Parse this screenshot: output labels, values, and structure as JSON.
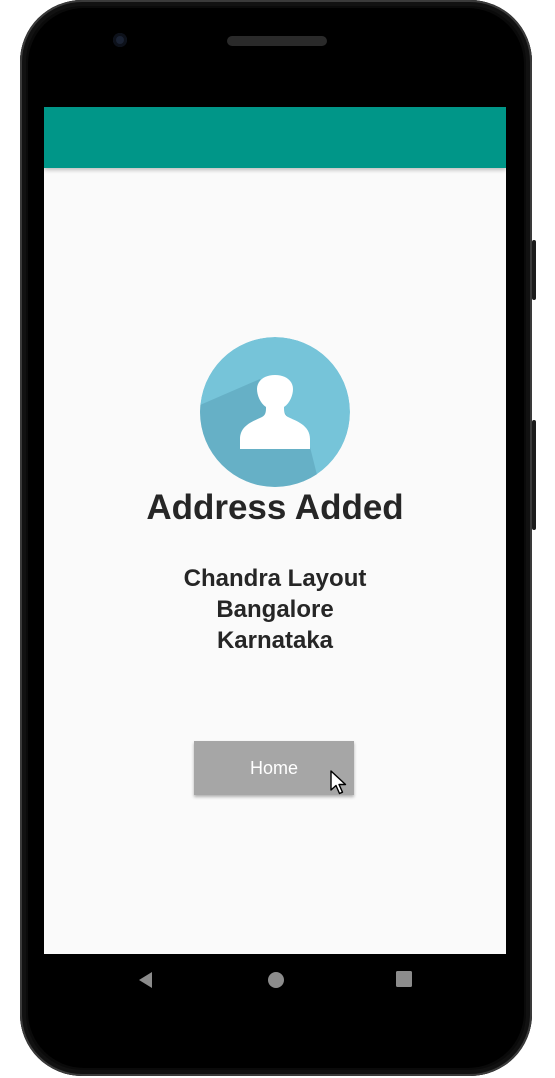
{
  "screen": {
    "title": "Address Added",
    "address_lines": [
      "Chandra Layout",
      "Bangalore",
      "Karnataka"
    ],
    "home_button_label": "Home"
  },
  "colors": {
    "app_bar": "#009688",
    "avatar_circle": "#76c4d9",
    "avatar_shadow": "#5fa8bd",
    "button_bg": "#a6a6a6",
    "screen_bg": "#fafafa"
  },
  "icons": {
    "avatar": "user-avatar-icon",
    "nav_back": "back-triangle-icon",
    "nav_home": "home-circle-icon",
    "nav_recents": "recents-square-icon",
    "pointer": "mouse-pointer-icon"
  }
}
